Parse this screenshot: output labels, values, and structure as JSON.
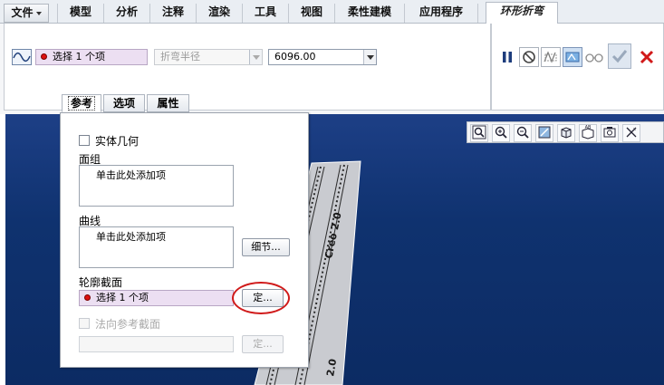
{
  "menu": {
    "file": "文件",
    "tabs": [
      "模型",
      "分析",
      "注释",
      "渲染",
      "工具",
      "视图",
      "柔性建模",
      "应用程序"
    ],
    "active_tab": "环形折弯"
  },
  "dashboard": {
    "collector": "选择 1 个项",
    "radius_type": "折弯半径",
    "value": "6096.00"
  },
  "subtabs": [
    "参考",
    "选项",
    "属性"
  ],
  "panel": {
    "solid_geometry": "实体几何",
    "quilts_label": "面组",
    "quilts_placeholder": "单击此处添加项",
    "curves_label": "曲线",
    "curves_placeholder": "单击此处添加项",
    "details_button": "细节...",
    "profile_label": "轮廓截面",
    "profile_collector": "选择 1 个项",
    "define_button": "定...",
    "normal_ref_label": "法向参考截面",
    "define_button_disabled": "定..."
  },
  "model": {
    "text": "Creo 2.0",
    "text_lower": "2.0"
  },
  "colors": {
    "viewport": "#0f326f",
    "collector_bg": "#ecdff2",
    "highlight": "#d01a1a"
  }
}
